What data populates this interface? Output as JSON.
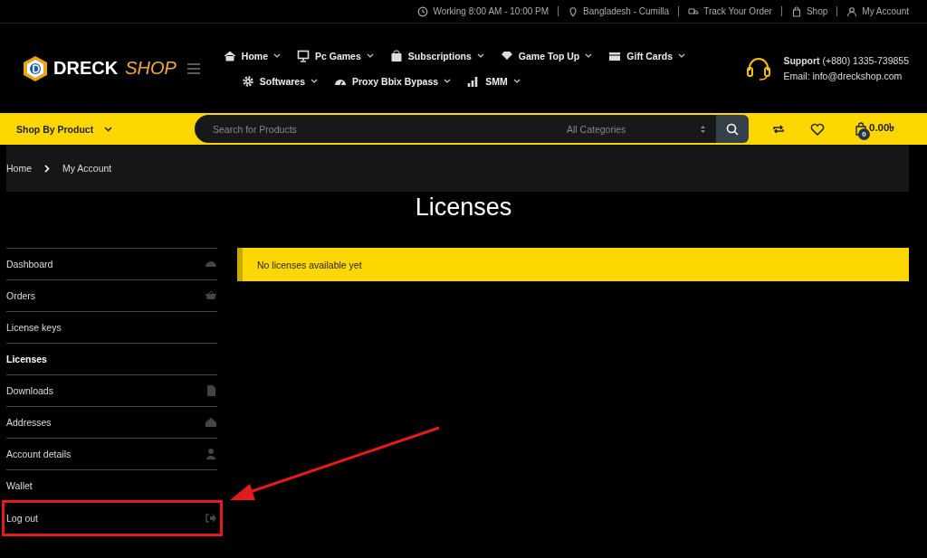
{
  "top_bar": {
    "items": [
      "Working 8:00 AM - 10:00 PM",
      "Bangladesh - Cumilla",
      "Track Your Order",
      "Shop",
      "My Account"
    ]
  },
  "logo": {
    "word1": "DRECK",
    "word2": "SHOP"
  },
  "nav": {
    "row1": [
      "Home",
      "Pc Games",
      "Subscriptions",
      "Game Top Up",
      "Gift Cards"
    ],
    "row2": [
      "Softwares",
      "Proxy Bbix Bypass",
      "SMM"
    ]
  },
  "support": {
    "label": "Support",
    "phone": "(+880) 1335-739855",
    "email": "Email: info@dreckshop.com"
  },
  "category_bar": {
    "shop_by": "Shop By Product",
    "search_placeholder": "Search for Products",
    "category": "All Categories",
    "cart_count": "0",
    "cart_total": "0.00৳"
  },
  "breadcrumb": [
    "Home",
    "My Account"
  ],
  "page_title": "Licenses",
  "sidebar": {
    "items": [
      {
        "label": "Dashboard",
        "selected": false,
        "highlighted": false
      },
      {
        "label": "Orders",
        "selected": false,
        "highlighted": false
      },
      {
        "label": "License keys",
        "selected": false,
        "highlighted": false
      },
      {
        "label": "Licenses",
        "selected": true,
        "highlighted": false
      },
      {
        "label": "Downloads",
        "selected": false,
        "highlighted": false
      },
      {
        "label": "Addresses",
        "selected": false,
        "highlighted": false
      },
      {
        "label": "Account details",
        "selected": false,
        "highlighted": false
      },
      {
        "label": "Wallet",
        "selected": false,
        "highlighted": false
      },
      {
        "label": "Log out",
        "selected": false,
        "highlighted": true
      }
    ]
  },
  "notice": "No licenses available yet"
}
